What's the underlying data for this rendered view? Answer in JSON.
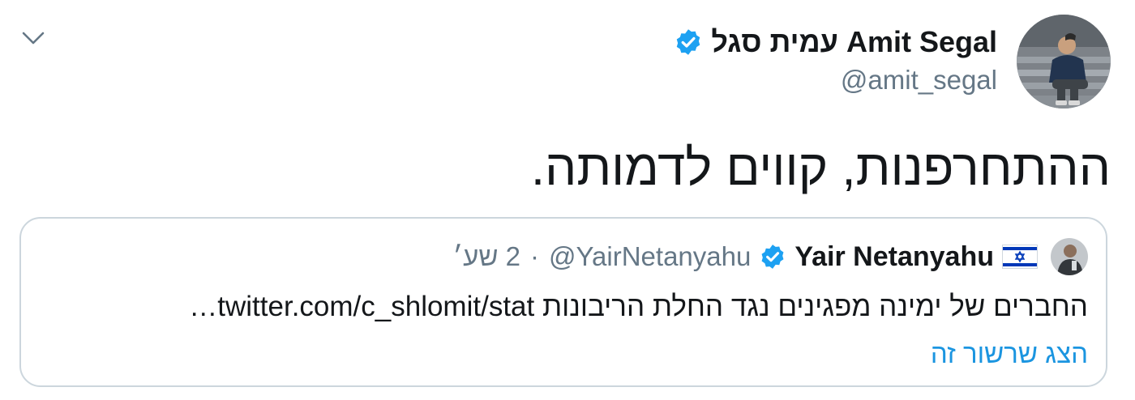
{
  "author": {
    "display_name": "עמית סגל Amit Segal",
    "handle": "@amit_segal",
    "verified_icon": "verified-badge-icon",
    "avatar_icon": "profile-photo-avatar"
  },
  "menu": {
    "icon": "chevron-down-icon"
  },
  "tweet": {
    "text": "ההתחרפנות, קווים לדמותה."
  },
  "quoted_tweet": {
    "display_name": "Yair Netanyahu",
    "flag_icon": "israel-flag-icon",
    "verified_icon": "verified-badge-icon",
    "handle": "@YairNetanyahu",
    "separator": "·",
    "time": "2 שע׳",
    "text": "החברים של ימינה מפגינים נגד החלת הריבונות twitter.com/c_shlomit/stat…",
    "show_thread": "הצג שרשור זה"
  },
  "colors": {
    "verified_blue": "#1da1f2",
    "link_blue": "#1b95e0",
    "muted_gray": "#657786",
    "border": "#ccd6dd",
    "text": "#14171a"
  }
}
